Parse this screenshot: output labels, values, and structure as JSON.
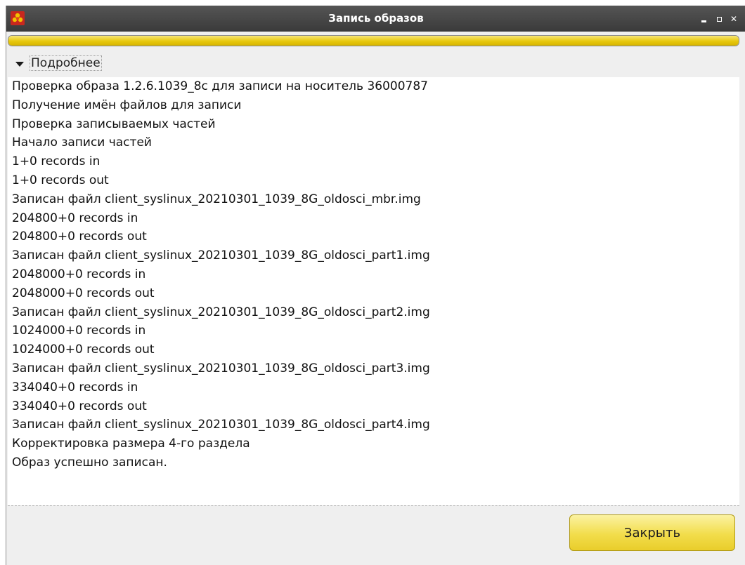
{
  "window": {
    "title": "Запись образов",
    "icon": "flower-app-icon",
    "controls": {
      "minimize": "minimize-icon",
      "maximize": "maximize-icon",
      "close_glyph": "✕"
    }
  },
  "progress": {
    "fraction": 1.0,
    "color": "#e7c80d"
  },
  "expander": {
    "label": "Подробнее",
    "state": "expanded"
  },
  "log": {
    "lines": [
      "Проверка образа 1.2.6.1039_8c для записи на носитель 36000787",
      "Получение имён файлов для записи",
      "Проверка записываемых частей",
      "Начало записи частей",
      "1+0 records in",
      "1+0 records out",
      "Записан файл client_syslinux_20210301_1039_8G_oldosci_mbr.img",
      "204800+0 records in",
      "204800+0 records out",
      "Записан файл client_syslinux_20210301_1039_8G_oldosci_part1.img",
      "2048000+0 records in",
      "2048000+0 records out",
      "Записан файл client_syslinux_20210301_1039_8G_oldosci_part2.img",
      "1024000+0 records in",
      "1024000+0 records out",
      "Записан файл client_syslinux_20210301_1039_8G_oldosci_part3.img",
      "334040+0 records in",
      "334040+0 records out",
      "Записан файл client_syslinux_20210301_1039_8G_oldosci_part4.img",
      "Корректировка размера 4-го раздела",
      "Образ успешно записан."
    ]
  },
  "buttons": {
    "close_label": "Закрыть"
  }
}
